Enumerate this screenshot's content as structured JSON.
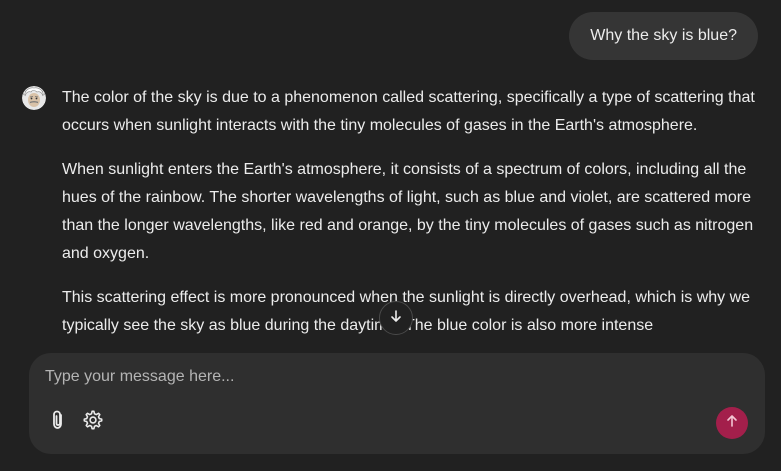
{
  "user_message": {
    "text": "Why the sky is blue?"
  },
  "assistant_message": {
    "avatar_icon": "einstein-avatar-icon",
    "paragraphs": [
      "The color of the sky is due to a phenomenon called scattering, specifically a type of scattering that occurs when sunlight interacts with the tiny molecules of gases in the Earth's atmosphere.",
      "When sunlight enters the Earth's atmosphere, it consists of a spectrum of colors, including all the hues of the rainbow. The shorter wavelengths of light, such as blue and violet, are scattered more than the longer wavelengths, like red and orange, by the tiny molecules of gases such as nitrogen and oxygen.",
      "This scattering effect is more pronounced when the sunlight is directly overhead, which is why we typically see the sky as blue during the daytime. The blue color is also more intense"
    ]
  },
  "scroll_down_icon": "arrow-down-icon",
  "composer": {
    "placeholder": "Type your message here...",
    "attach_icon": "paperclip-icon",
    "settings_icon": "gear-icon",
    "send_icon": "arrow-up-icon",
    "send_color": "#a31f4b"
  },
  "colors": {
    "background": "#212121",
    "bubble": "#353535",
    "composer": "#2f2f2f",
    "text": "#ececec"
  }
}
